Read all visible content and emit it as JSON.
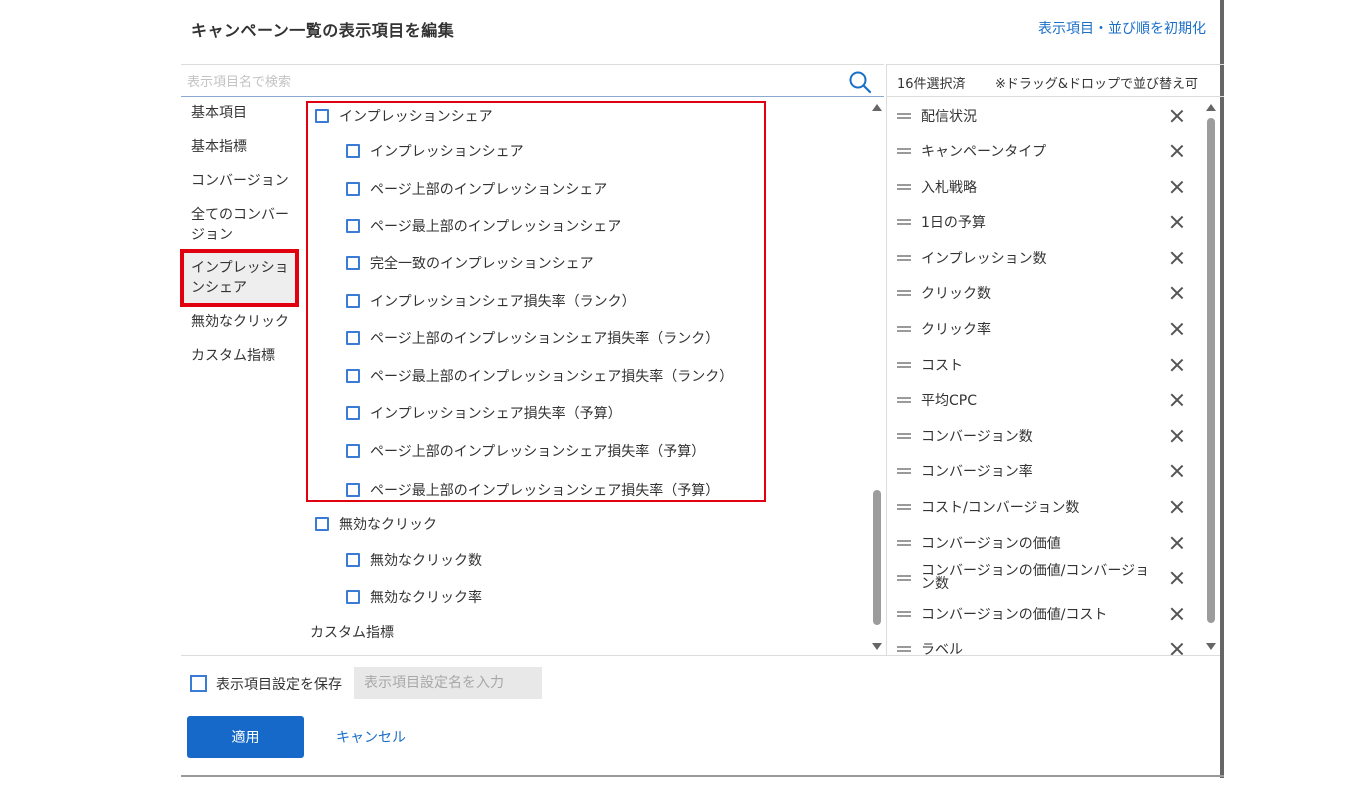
{
  "dialog": {
    "title": "キャンペーン一覧の表示項目を編集",
    "reset_link": "表示項目・並び順を初期化"
  },
  "search": {
    "placeholder": "表示項目名で検索",
    "icon": "search-icon"
  },
  "selected_panel": {
    "count_label": "16件選択済",
    "drag_note": "※ドラッグ&ドロップで並び替え可",
    "items": [
      "配信状況",
      "キャンペーンタイプ",
      "入札戦略",
      "1日の予算",
      "インプレッション数",
      "クリック数",
      "クリック率",
      "コスト",
      "平均CPC",
      "コンバージョン数",
      "コンバージョン率",
      "コスト/コンバージョン数",
      "コンバージョンの価値",
      "コンバージョンの価値/コンバージョン数",
      "コンバージョンの価値/コスト",
      "ラベル"
    ]
  },
  "categories": [
    "基本項目",
    "基本指標",
    "コンバージョン",
    "全てのコンバージョン",
    "インプレッションシェア",
    "無効なクリック",
    "カスタム指標"
  ],
  "active_category": "インプレッションシェア",
  "list": {
    "impression_share_group": "インプレッションシェア",
    "impression_share_items": [
      "インプレッションシェア",
      "ページ上部のインプレッションシェア",
      "ページ最上部のインプレッションシェア",
      "完全一致のインプレッションシェア",
      "インプレッションシェア損失率（ランク）",
      "ページ上部のインプレッションシェア損失率（ランク）",
      "ページ最上部のインプレッションシェア損失率（ランク）",
      "インプレッションシェア損失率（予算）",
      "ページ上部のインプレッションシェア損失率（予算）",
      "ページ最上部のインプレッションシェア損失率（予算）"
    ],
    "invalid_click_group": "無効なクリック",
    "invalid_click_items": [
      "無効なクリック数",
      "無効なクリック率"
    ],
    "custom_group": "カスタム指標"
  },
  "footer": {
    "save_settings_label": "表示項目設定を保存",
    "save_name_placeholder": "表示項目設定名を入力",
    "apply_label": "適用",
    "cancel_label": "キャンセル"
  },
  "colors": {
    "accent": "#1769c9",
    "highlight": "#e0000f",
    "link": "#1a6fc9"
  }
}
